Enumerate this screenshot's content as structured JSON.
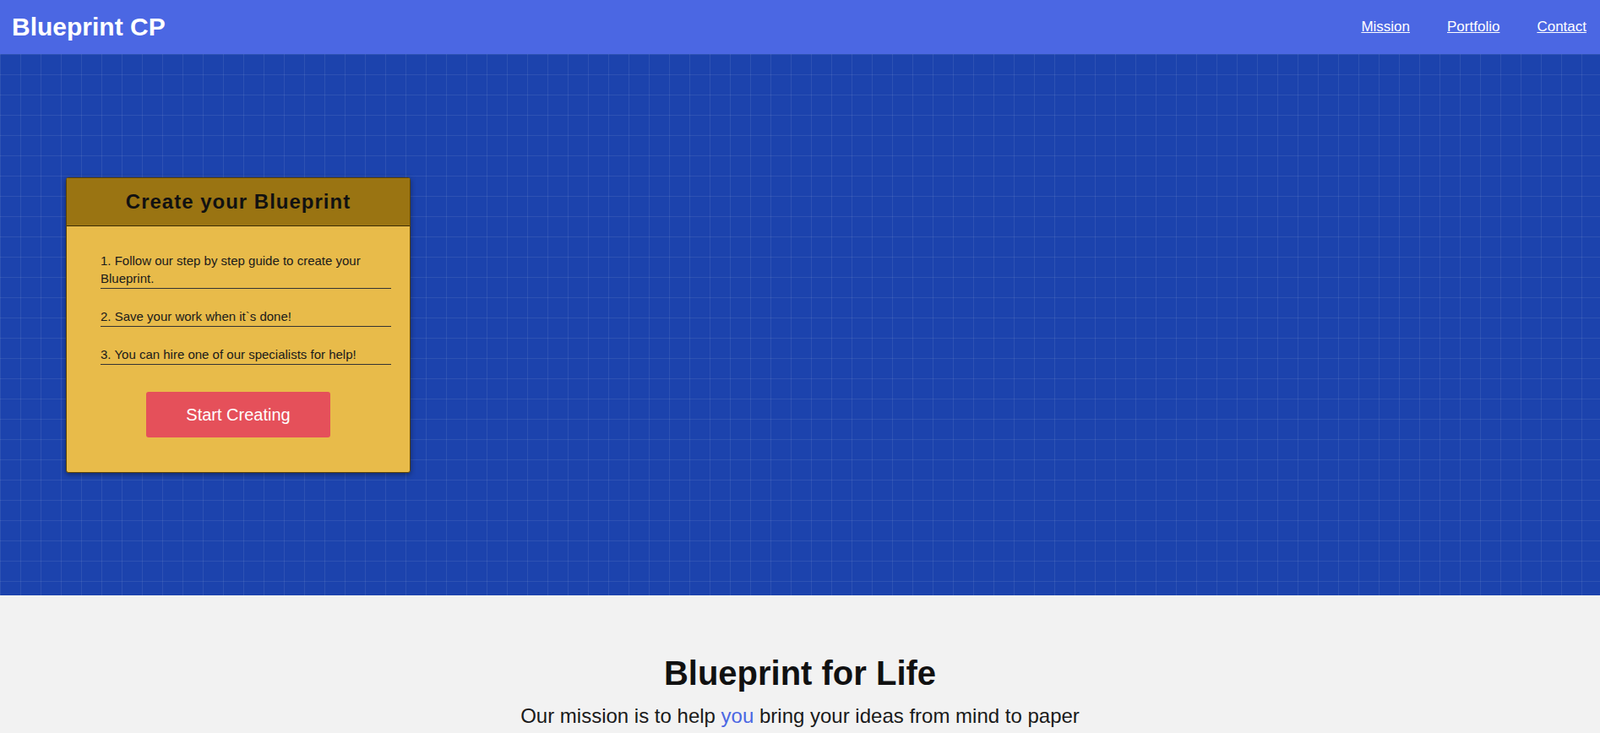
{
  "nav": {
    "logo": "Blueprint CP",
    "links": [
      "Mission",
      "Portfolio",
      "Contact"
    ]
  },
  "hero": {
    "card": {
      "title": "Create your Blueprint",
      "steps": [
        "1. Follow our step by step guide to create your Blueprint.",
        "2. Save your work when it`s done!",
        "3. You can hire one of our specialists for help!"
      ],
      "button": "Start Creating"
    }
  },
  "mission": {
    "title": "Blueprint for Life",
    "subtitle": [
      {
        "text": "Our mission is to help ",
        "highlighted": false
      },
      {
        "text": "you",
        "highlighted": true
      },
      {
        "text": " bring your ideas from mind to paper",
        "highlighted": false
      }
    ]
  }
}
